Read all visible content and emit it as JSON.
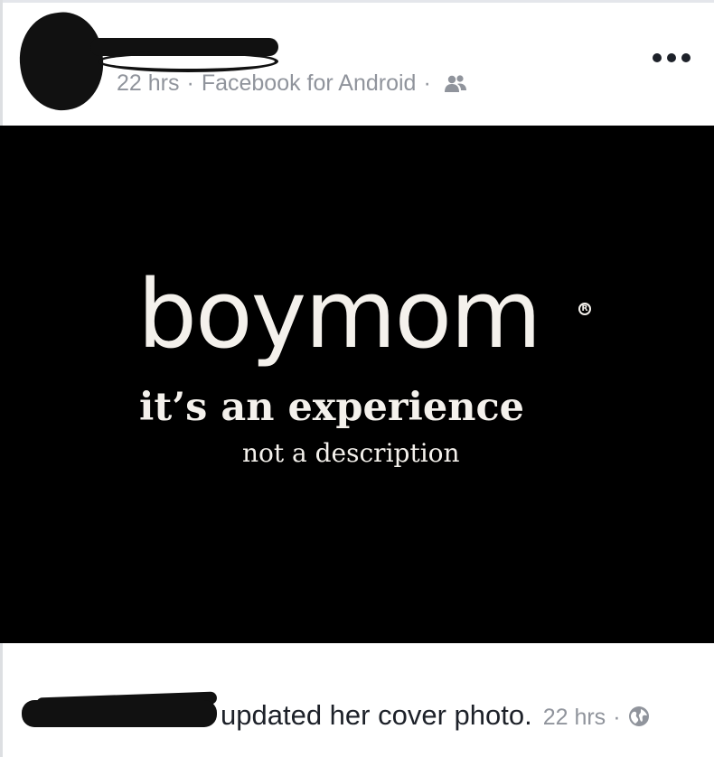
{
  "post": {
    "time": "22 hrs",
    "separator": "·",
    "source": "Facebook for Android",
    "audience_icon": "friends-icon",
    "more_icon": "more-options-icon"
  },
  "photo": {
    "brand": "boymom",
    "registered_mark": "R",
    "tagline": "it’s an experience",
    "subtagline": "not a description"
  },
  "story": {
    "action": "updated her cover photo.",
    "time": "22 hrs",
    "separator": "·",
    "privacy_icon": "globe-icon"
  }
}
